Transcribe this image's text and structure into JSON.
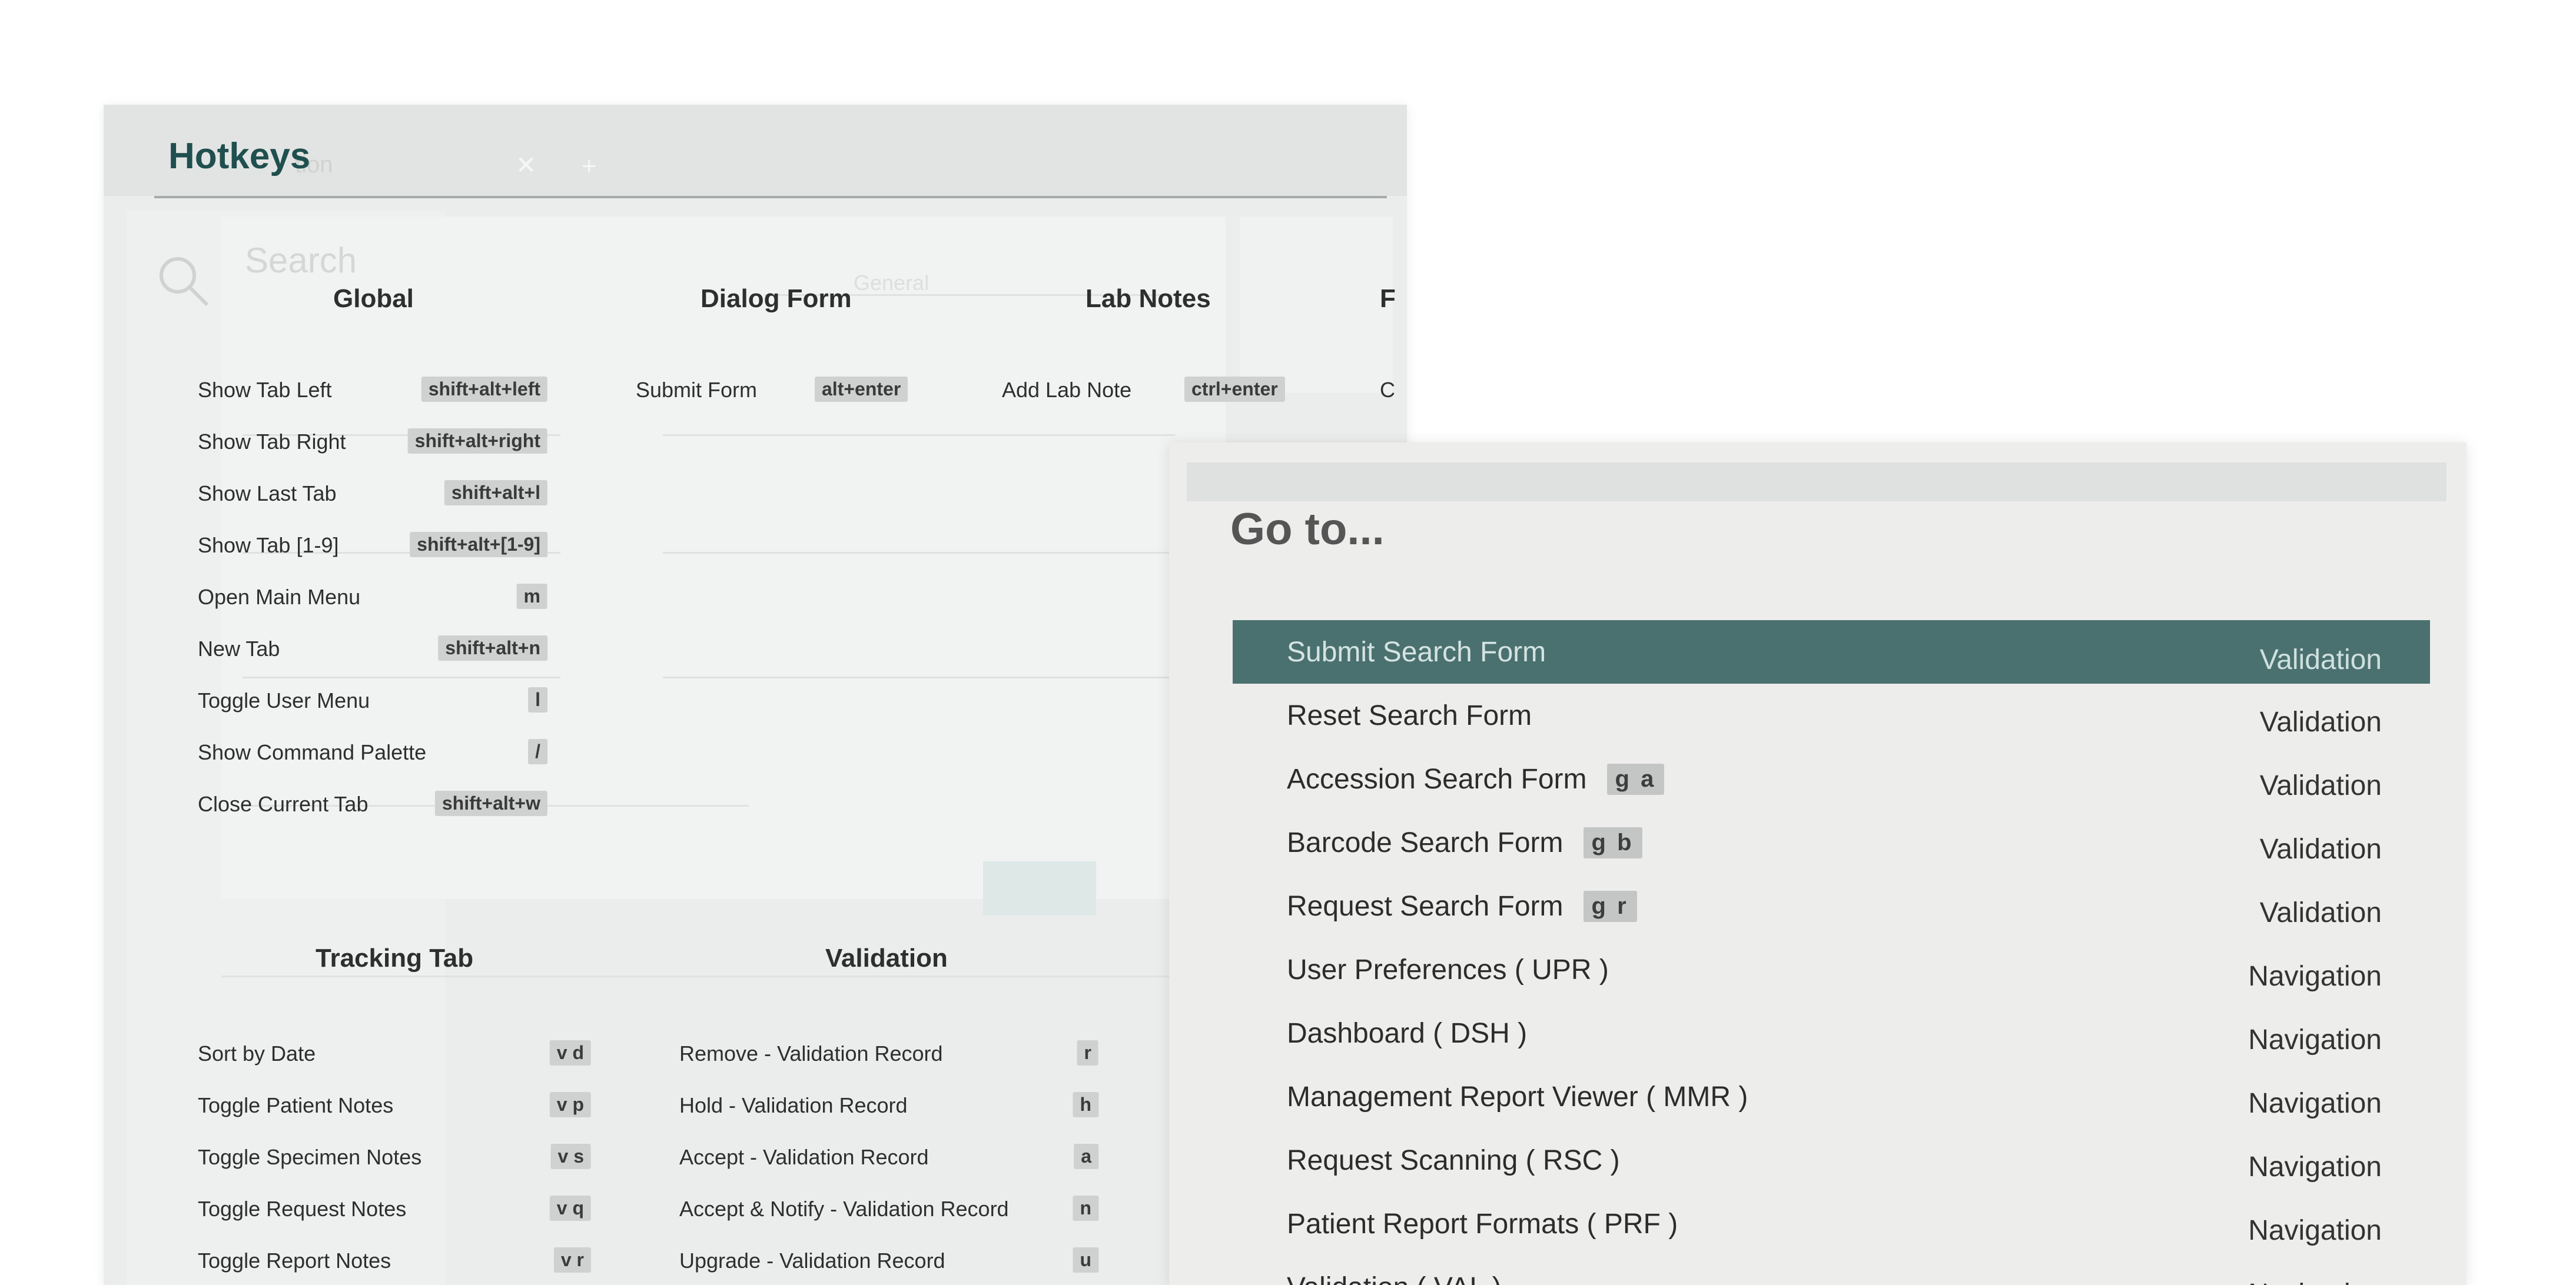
{
  "hotkeys": {
    "title": "Hotkeys",
    "background_app": {
      "search_label": "Search",
      "general": "General"
    },
    "global": {
      "heading": "Global",
      "items": [
        {
          "label": "Show Tab Left",
          "key": "shift+alt+left"
        },
        {
          "label": "Show Tab Right",
          "key": "shift+alt+right"
        },
        {
          "label": "Show Last Tab",
          "key": "shift+alt+l"
        },
        {
          "label": "Show Tab [1-9]",
          "key": "shift+alt+[1-9]"
        },
        {
          "label": "Open Main Menu",
          "key": "m"
        },
        {
          "label": "New Tab",
          "key": "shift+alt+n"
        },
        {
          "label": "Toggle User Menu",
          "key": "l"
        },
        {
          "label": "Show Command Palette",
          "key": "/"
        },
        {
          "label": "Close Current Tab",
          "key": "shift+alt+w"
        }
      ]
    },
    "dialog_form": {
      "heading": "Dialog Form",
      "items": [
        {
          "label": "Submit Form",
          "key": "alt+enter"
        }
      ]
    },
    "lab_notes": {
      "heading": "Lab Notes",
      "items": [
        {
          "label": "Add Lab Note",
          "key": "ctrl+enter"
        }
      ]
    },
    "cut_off_column": {
      "heading_fragment": "F",
      "item_fragment": "C"
    },
    "tracking_tab": {
      "heading": "Tracking Tab",
      "items": [
        {
          "label": "Sort by Date",
          "key": "v d"
        },
        {
          "label": "Toggle Patient Notes",
          "key": "v p"
        },
        {
          "label": "Toggle Specimen Notes",
          "key": "v s"
        },
        {
          "label": "Toggle Request Notes",
          "key": "v q"
        },
        {
          "label": "Toggle Report Notes",
          "key": "v r"
        }
      ]
    },
    "validation": {
      "heading": "Validation",
      "items": [
        {
          "label": "Remove - Validation Record",
          "key": "r"
        },
        {
          "label": "Hold - Validation Record",
          "key": "h"
        },
        {
          "label": "Accept - Validation Record",
          "key": "a"
        },
        {
          "label": "Accept & Notify - Validation Record",
          "key": "n"
        },
        {
          "label": "Upgrade - Validation Record",
          "key": "u"
        }
      ]
    }
  },
  "goto": {
    "title": "Go to...",
    "items": [
      {
        "label": "Submit Search Form",
        "key": "",
        "category": "Validation",
        "selected": true
      },
      {
        "label": "Reset Search Form",
        "key": "",
        "category": "Validation",
        "selected": false
      },
      {
        "label": "Accession Search Form",
        "key": "g a",
        "category": "Validation",
        "selected": false
      },
      {
        "label": "Barcode Search Form",
        "key": "g b",
        "category": "Validation",
        "selected": false
      },
      {
        "label": "Request Search Form",
        "key": "g r",
        "category": "Validation",
        "selected": false
      },
      {
        "label": "User Preferences ( UPR )",
        "key": "",
        "category": "Navigation",
        "selected": false
      },
      {
        "label": "Dashboard ( DSH )",
        "key": "",
        "category": "Navigation",
        "selected": false
      },
      {
        "label": "Management Report Viewer ( MMR )",
        "key": "",
        "category": "Navigation",
        "selected": false
      },
      {
        "label": "Request Scanning ( RSC )",
        "key": "",
        "category": "Navigation",
        "selected": false
      },
      {
        "label": "Patient Report Formats ( PRF )",
        "key": "",
        "category": "Navigation",
        "selected": false
      },
      {
        "label": "Validation ( VAL )",
        "key": "",
        "category": "Navigation",
        "selected": false
      }
    ],
    "colors": {
      "selected_row": "#4a7170",
      "shortcut_badge": "#c4c6c5"
    }
  },
  "colors": {
    "hotkeys_title": "#1f4f4e",
    "key_badge": "#cfd1d0",
    "panel_bg": "#ebedec"
  }
}
